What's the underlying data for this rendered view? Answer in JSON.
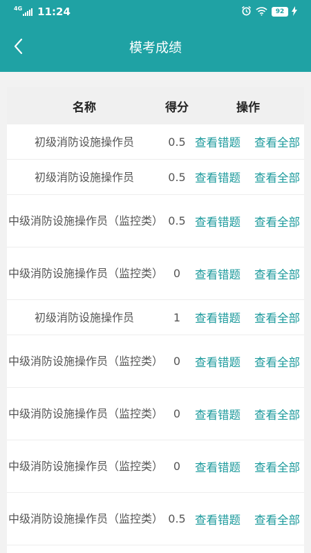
{
  "status_bar": {
    "network": "4G",
    "time": "11:24",
    "battery": "92"
  },
  "header": {
    "title": "模考成绩"
  },
  "table": {
    "headers": {
      "name": "名称",
      "score": "得分",
      "actions": "操作"
    },
    "action_labels": {
      "view_wrong": "查看错题",
      "view_all": "查看全部"
    },
    "rows": [
      {
        "name": "初级消防设施操作员",
        "score": "0.5"
      },
      {
        "name": "初级消防设施操作员",
        "score": "0.5"
      },
      {
        "name": "中级消防设施操作员（监控类）",
        "score": "0.5"
      },
      {
        "name": "中级消防设施操作员（监控类）",
        "score": "0"
      },
      {
        "name": "初级消防设施操作员",
        "score": "1"
      },
      {
        "name": "中级消防设施操作员（监控类）",
        "score": "0"
      },
      {
        "name": "中级消防设施操作员（监控类）",
        "score": "0"
      },
      {
        "name": "中级消防设施操作员（监控类）",
        "score": "0"
      },
      {
        "name": "中级消防设施操作员（监控类）",
        "score": "0.5"
      }
    ]
  },
  "colors": {
    "primary": "#1fa2a4",
    "link": "#1c9a9c",
    "header_row_bg": "#f0f0f0",
    "page_bg": "#f2f2f2"
  }
}
